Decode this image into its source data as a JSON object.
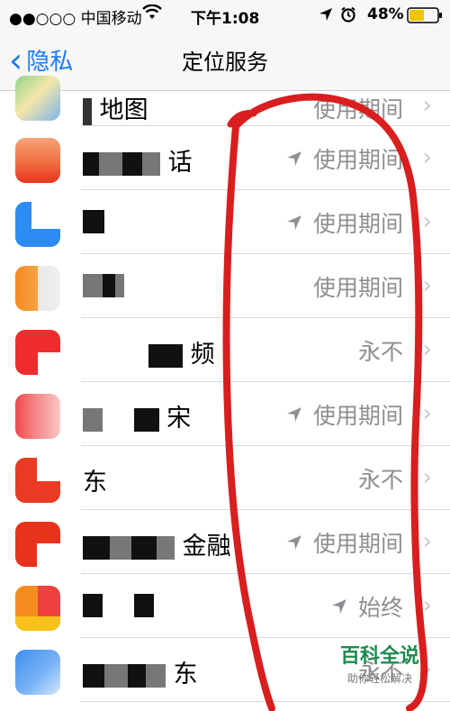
{
  "status_bar": {
    "carrier": "●●○○○ 中国移动",
    "time": "下午1:08",
    "battery": "48%"
  },
  "nav": {
    "back_label": "隐私",
    "title": "定位服务"
  },
  "apps": [
    {
      "name": "地图",
      "status": "使用期间",
      "arrow": false
    },
    {
      "name": "话",
      "status": "使用期间",
      "arrow": true
    },
    {
      "name": "",
      "status": "使用期间",
      "arrow": true
    },
    {
      "name": "",
      "status": "使用期间",
      "arrow": false
    },
    {
      "name": "频",
      "status": "永不",
      "arrow": false
    },
    {
      "name": "宋",
      "status": "使用期间",
      "arrow": true
    },
    {
      "name": "东",
      "status": "永不",
      "arrow": false
    },
    {
      "name": "金融",
      "status": "使用期间",
      "arrow": true
    },
    {
      "name": "",
      "status": "始终",
      "arrow": true
    },
    {
      "name": "东",
      "status": "永不",
      "arrow": false
    }
  ],
  "watermark": {
    "title": "百科全说",
    "subtitle": "助你轻松解决"
  },
  "colors": {
    "ios_blue": "#1d7bf2",
    "annotation_red": "#d81e1e",
    "watermark_green": "#1e8a4f"
  }
}
